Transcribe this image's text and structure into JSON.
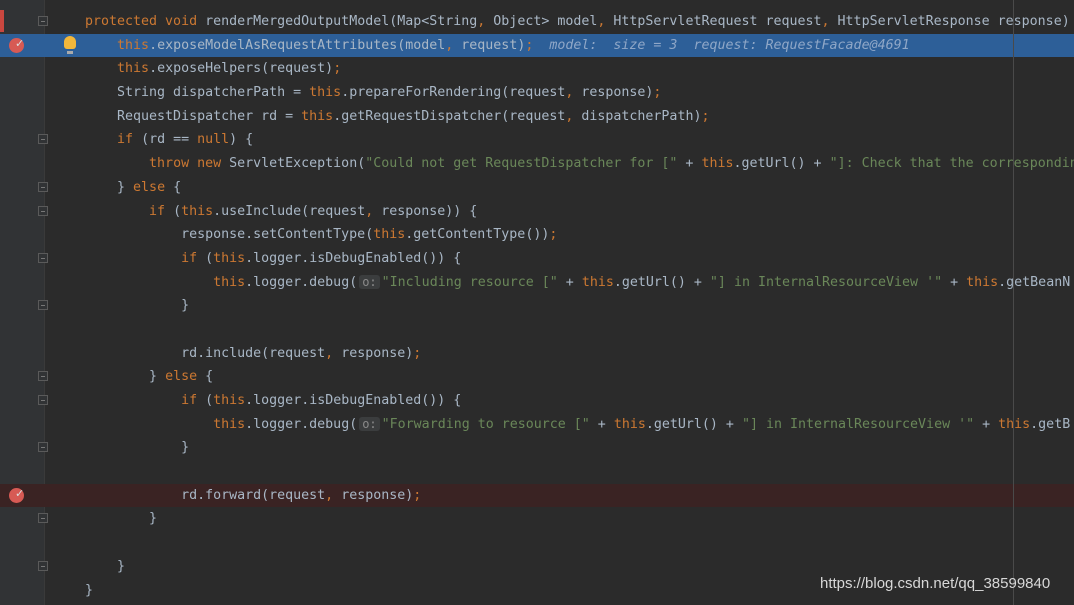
{
  "editor": {
    "colors": {
      "keyword": "#cc7832",
      "string": "#6a8759",
      "plain": "#a9b7c6",
      "execution_line": "#2d5f98",
      "breakpoint_line": "#3a2323",
      "breakpoint": "#d75a54"
    },
    "lines": [
      {
        "fold": true,
        "tokens": [
          [
            "k",
            "protected void "
          ],
          [
            "p",
            "renderMergedOutputModel(Map<String"
          ],
          [
            "k",
            ", "
          ],
          [
            "p",
            "Object> model"
          ],
          [
            "k",
            ", "
          ],
          [
            "p",
            "HttpServletRequest request"
          ],
          [
            "k",
            ", "
          ],
          [
            "p",
            "HttpServletResponse response)"
          ]
        ]
      },
      {
        "exec": true,
        "breakpoint": true,
        "bulb": true,
        "tokens": [
          [
            "p",
            "    "
          ],
          [
            "k",
            "this"
          ],
          [
            "p",
            ".exposeModelAsRequestAttributes(model"
          ],
          [
            "k",
            ", "
          ],
          [
            "p",
            "request)"
          ],
          [
            "k",
            ";"
          ],
          [
            "h",
            "  model:  size = 3  request: RequestFacade@4691"
          ]
        ]
      },
      {
        "tokens": [
          [
            "p",
            "    "
          ],
          [
            "k",
            "this"
          ],
          [
            "p",
            ".exposeHelpers(request)"
          ],
          [
            "k",
            ";"
          ]
        ]
      },
      {
        "tokens": [
          [
            "p",
            "    String dispatcherPath = "
          ],
          [
            "k",
            "this"
          ],
          [
            "p",
            ".prepareForRendering(request"
          ],
          [
            "k",
            ", "
          ],
          [
            "p",
            "response)"
          ],
          [
            "k",
            ";"
          ]
        ]
      },
      {
        "tokens": [
          [
            "p",
            "    RequestDispatcher rd = "
          ],
          [
            "k",
            "this"
          ],
          [
            "p",
            ".getRequestDispatcher(request"
          ],
          [
            "k",
            ", "
          ],
          [
            "p",
            "dispatcherPath)"
          ],
          [
            "k",
            ";"
          ]
        ]
      },
      {
        "fold": true,
        "tokens": [
          [
            "p",
            "    "
          ],
          [
            "k",
            "if "
          ],
          [
            "p",
            "(rd == "
          ],
          [
            "k",
            "null"
          ],
          [
            "p",
            ") {"
          ]
        ]
      },
      {
        "tokens": [
          [
            "p",
            "        "
          ],
          [
            "k",
            "throw new "
          ],
          [
            "p",
            "ServletException("
          ],
          [
            "s",
            "\"Could not get RequestDispatcher for [\""
          ],
          [
            "p",
            " + "
          ],
          [
            "k",
            "this"
          ],
          [
            "p",
            ".getUrl() + "
          ],
          [
            "s",
            "\"]: Check that the corresponding"
          ]
        ]
      },
      {
        "fold": true,
        "tokens": [
          [
            "p",
            "    } "
          ],
          [
            "k",
            "else "
          ],
          [
            "p",
            "{"
          ]
        ]
      },
      {
        "fold": true,
        "tokens": [
          [
            "p",
            "        "
          ],
          [
            "k",
            "if "
          ],
          [
            "p",
            "("
          ],
          [
            "k",
            "this"
          ],
          [
            "p",
            ".useInclude(request"
          ],
          [
            "k",
            ", "
          ],
          [
            "p",
            "response)) {"
          ]
        ]
      },
      {
        "tokens": [
          [
            "p",
            "            response.setContentType("
          ],
          [
            "k",
            "this"
          ],
          [
            "p",
            ".getContentType())"
          ],
          [
            "k",
            ";"
          ]
        ]
      },
      {
        "fold": true,
        "tokens": [
          [
            "p",
            "            "
          ],
          [
            "k",
            "if "
          ],
          [
            "p",
            "("
          ],
          [
            "k",
            "this"
          ],
          [
            "p",
            ".logger.isDebugEnabled()) {"
          ]
        ]
      },
      {
        "tokens": [
          [
            "p",
            "                "
          ],
          [
            "k",
            "this"
          ],
          [
            "p",
            ".logger.debug("
          ],
          [
            "b",
            "o:"
          ],
          [
            "s",
            "\"Including resource [\""
          ],
          [
            "p",
            " + "
          ],
          [
            "k",
            "this"
          ],
          [
            "p",
            ".getUrl() + "
          ],
          [
            "s",
            "\"] in InternalResourceView '\""
          ],
          [
            "p",
            " + "
          ],
          [
            "k",
            "this"
          ],
          [
            "p",
            ".getBeanN"
          ]
        ]
      },
      {
        "fold": true,
        "tokens": [
          [
            "p",
            "            }"
          ]
        ]
      },
      {
        "tokens": []
      },
      {
        "tokens": [
          [
            "p",
            "            rd.include(request"
          ],
          [
            "k",
            ", "
          ],
          [
            "p",
            "response)"
          ],
          [
            "k",
            ";"
          ]
        ]
      },
      {
        "fold": true,
        "tokens": [
          [
            "p",
            "        } "
          ],
          [
            "k",
            "else "
          ],
          [
            "p",
            "{"
          ]
        ]
      },
      {
        "fold": true,
        "tokens": [
          [
            "p",
            "            "
          ],
          [
            "k",
            "if "
          ],
          [
            "p",
            "("
          ],
          [
            "k",
            "this"
          ],
          [
            "p",
            ".logger.isDebugEnabled()) {"
          ]
        ]
      },
      {
        "tokens": [
          [
            "p",
            "                "
          ],
          [
            "k",
            "this"
          ],
          [
            "p",
            ".logger.debug("
          ],
          [
            "b",
            "o:"
          ],
          [
            "s",
            "\"Forwarding to resource [\""
          ],
          [
            "p",
            " + "
          ],
          [
            "k",
            "this"
          ],
          [
            "p",
            ".getUrl() + "
          ],
          [
            "s",
            "\"] in InternalResourceView '\""
          ],
          [
            "p",
            " + "
          ],
          [
            "k",
            "this"
          ],
          [
            "p",
            ".getB"
          ]
        ]
      },
      {
        "fold": true,
        "tokens": [
          [
            "p",
            "            }"
          ]
        ]
      },
      {
        "tokens": []
      },
      {
        "breakpoint": true,
        "bpline": true,
        "tokens": [
          [
            "p",
            "            rd.forward(request"
          ],
          [
            "k",
            ", "
          ],
          [
            "p",
            "response)"
          ],
          [
            "k",
            ";"
          ]
        ]
      },
      {
        "fold": true,
        "tokens": [
          [
            "p",
            "        }"
          ]
        ]
      },
      {
        "tokens": []
      },
      {
        "fold": true,
        "tokens": [
          [
            "p",
            "    }"
          ]
        ]
      },
      {
        "tokens": [
          [
            "p",
            "}"
          ]
        ]
      }
    ]
  },
  "watermark": "https://blog.csdn.net/qq_38599840"
}
